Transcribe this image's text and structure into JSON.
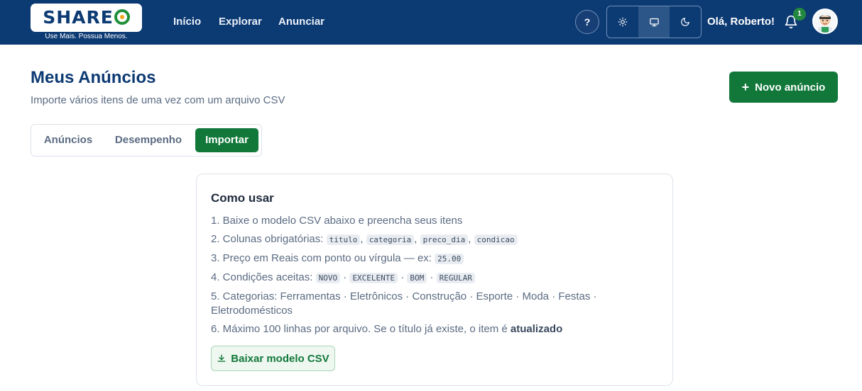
{
  "brand": {
    "name_left": "SHARE",
    "name_right": "",
    "slogan": "Use Mais. Possua Menos."
  },
  "nav": {
    "items": [
      "Início",
      "Explorar",
      "Anunciar"
    ]
  },
  "header": {
    "help_label": "?",
    "greeting": "Olá, Roberto!",
    "notification_count": "1",
    "theme_active": "system"
  },
  "page": {
    "title": "Meus Anúncios",
    "subtitle": "Importe vários itens de uma vez com um arquivo CSV",
    "new_button": "Novo anúncio",
    "new_button_icon": "+"
  },
  "tabs": {
    "items": [
      "Anúncios",
      "Desempenho",
      "Importar"
    ],
    "active": "Importar"
  },
  "card": {
    "title": "Como usar",
    "step1": "1. Baixe o modelo CSV abaixo e preencha seus itens",
    "step2_prefix": "2. Colunas obrigatórias: ",
    "step2_codes": [
      "titulo",
      "categoria",
      "preco_dia",
      "condicao"
    ],
    "step2_sep": ", ",
    "step3_prefix": "3. Preço em Reais com ponto ou vírgula — ex: ",
    "step3_code": "25.00",
    "step4_prefix": "4. Condições aceitas: ",
    "step4_codes": [
      "NOVO",
      "EXCELENTE",
      "BOM",
      "REGULAR"
    ],
    "step4_sep": " · ",
    "step5": "5. Categorias: Ferramentas · Eletrônicos · Construção · Esporte · Moda · Festas · Eletrodomésticos",
    "step6_prefix": "6. Máximo 100 linhas por arquivo. Se o título já existe, o item é ",
    "step6_bold": "atualizado",
    "download_button": "Baixar modelo CSV"
  },
  "colors": {
    "header_bg": "#0c3a73",
    "accent_green": "#12783a"
  }
}
